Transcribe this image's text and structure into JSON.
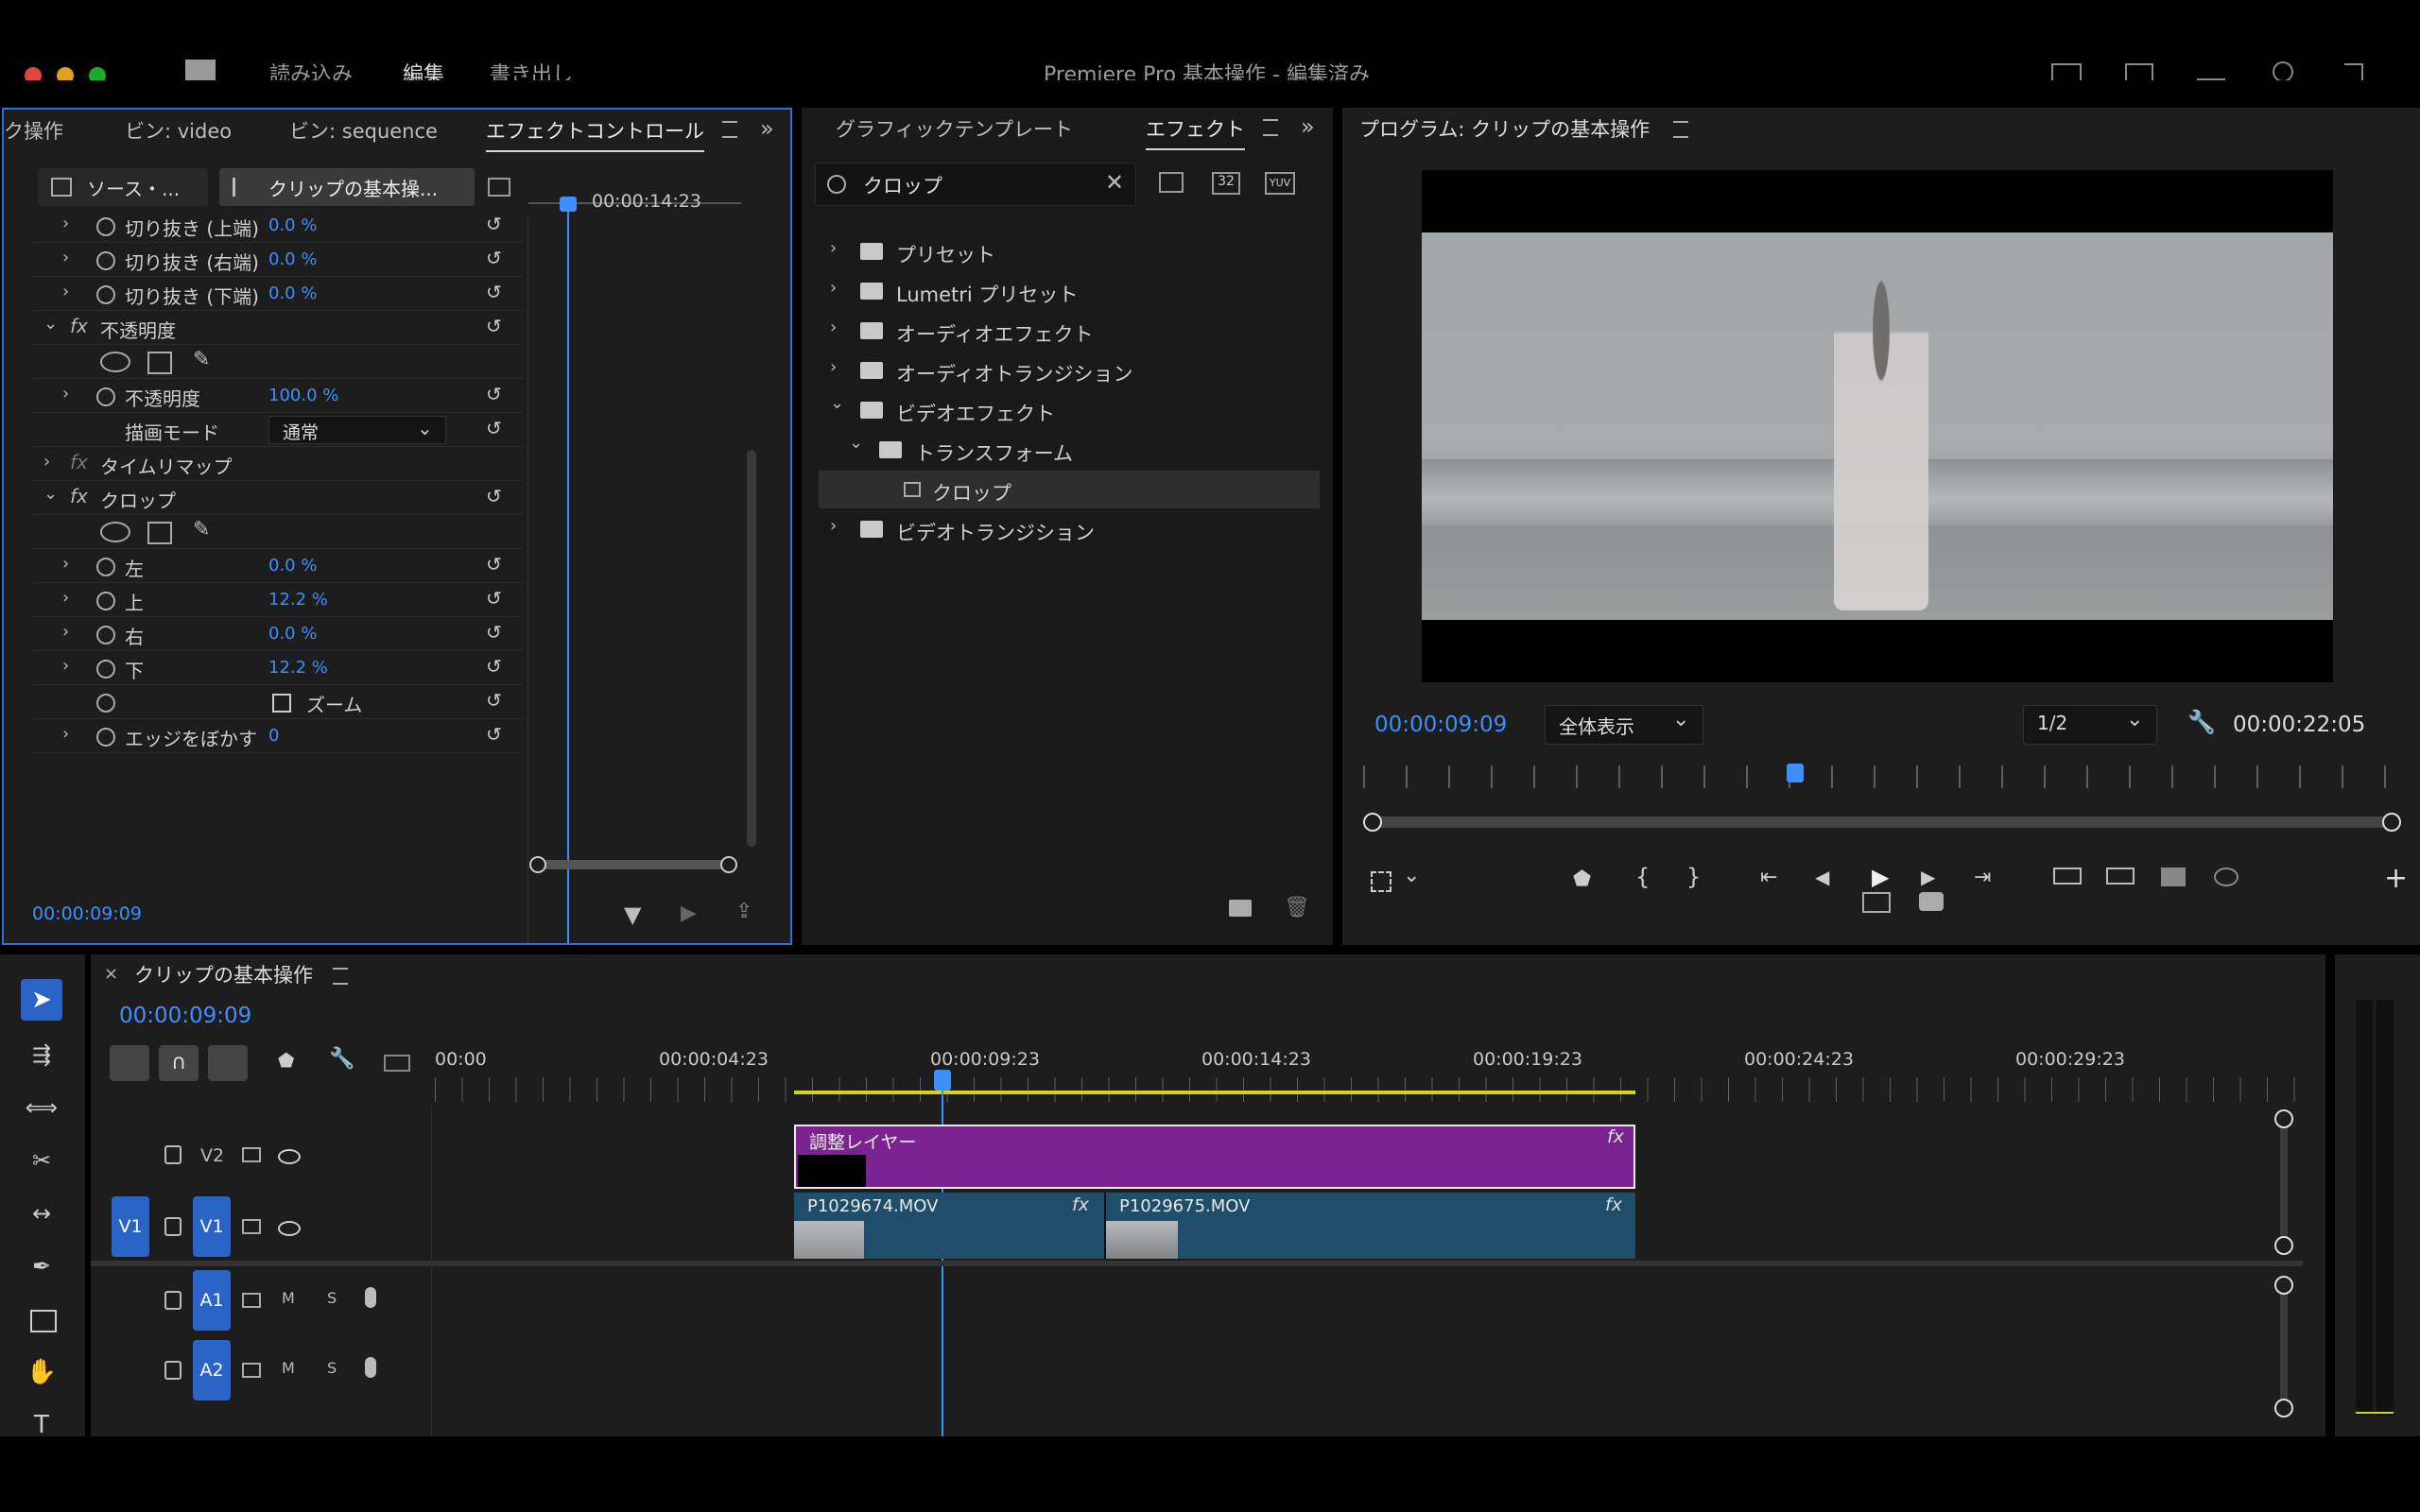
{
  "app": {
    "title": "Premiere Pro 基本操作 - 編集済み",
    "workspaces": [
      "読み込み",
      "編集",
      "書き出し"
    ],
    "active_workspace": "編集"
  },
  "effect_controls": {
    "tabs": [
      "ク操作",
      "ビン: video",
      "ビン: sequence",
      "エフェクトコントロール"
    ],
    "source_btn": "ソース・...",
    "clip_btn": "クリップの基本操...",
    "ruler_time": "00:00:14:23",
    "rows": {
      "crop_top_lbl": "切り抜き (上端)",
      "crop_top_val": "0.0 %",
      "crop_right_lbl": "切り抜き (右端)",
      "crop_right_val": "0.0 %",
      "crop_bottom_lbl": "切り抜き (下端)",
      "crop_bottom_val": "0.0 %",
      "opacity_group": "不透明度",
      "opacity_lbl": "不透明度",
      "opacity_val": "100.0 %",
      "blend_lbl": "描画モード",
      "blend_val": "通常",
      "timeremap": "タイムリマップ",
      "crop_group": "クロップ",
      "left_lbl": "左",
      "left_val": "0.0 %",
      "top_lbl": "上",
      "top_val": "12.2 %",
      "right_lbl": "右",
      "right_val": "0.0 %",
      "bottom_lbl": "下",
      "bottom_val": "12.2 %",
      "zoom_lbl": "ズーム",
      "feather_lbl": "エッジをぼかす",
      "feather_val": "0"
    },
    "footer_time": "00:00:09:09"
  },
  "effects_panel": {
    "tabs": [
      "グラフィックテンプレート",
      "エフェクト"
    ],
    "search_value": "クロップ",
    "badges": [
      "32",
      "YUV"
    ],
    "tree": {
      "presets": "プリセット",
      "lumetri": "Lumetri プリセット",
      "audio_fx": "オーディオエフェクト",
      "audio_tr": "オーディオトランジション",
      "video_fx": "ビデオエフェクト",
      "transform": "トランスフォーム",
      "crop": "クロップ",
      "video_tr": "ビデオトランジション"
    }
  },
  "program": {
    "title": "プログラム: クリップの基本操作",
    "current_time": "00:00:09:09",
    "fit": "全体表示",
    "resolution": "1/2",
    "duration": "00:00:22:05"
  },
  "timeline": {
    "title": "クリップの基本操作",
    "current_time": "00:00:09:09",
    "ruler": [
      "00:00",
      "00:00:04:23",
      "00:00:09:23",
      "00:00:14:23",
      "00:00:19:23",
      "00:00:24:23",
      "00:00:29:23"
    ],
    "tracks": {
      "v2": "V2",
      "v1": "V1",
      "a1": "A1",
      "a2": "A2",
      "m": "M",
      "s": "S"
    },
    "clips": {
      "adjust": "調整レイヤー",
      "clip1": "P1029674.MOV",
      "clip2": "P1029675.MOV",
      "fx": "fx"
    }
  },
  "colors": {
    "accent": "#3d8eff",
    "adjust_layer": "#7a2391",
    "video_clip": "#1f4e6b",
    "workarea": "#d6d21a",
    "track_btn": "#2b64c7"
  }
}
